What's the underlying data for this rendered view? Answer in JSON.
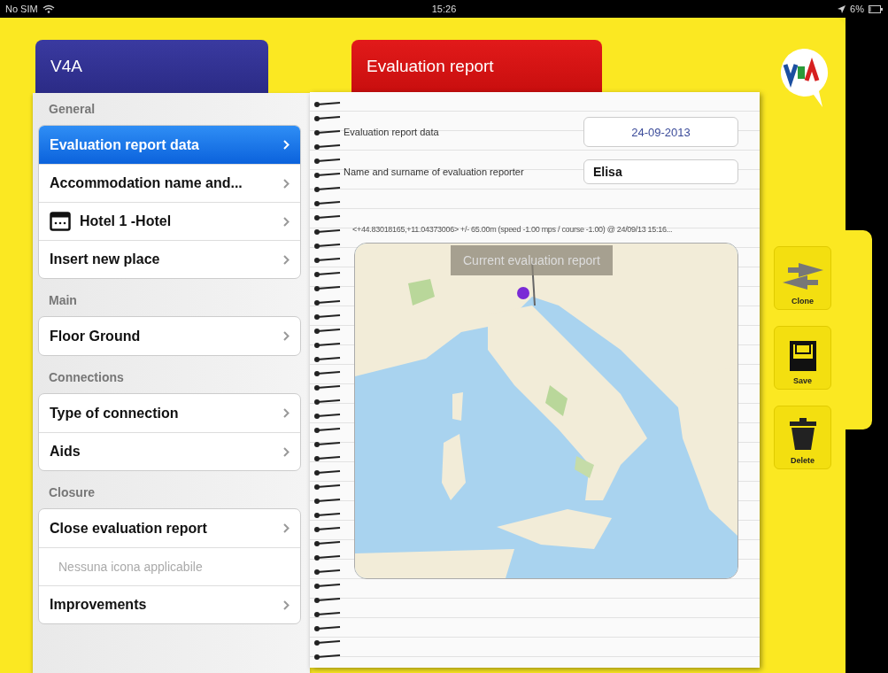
{
  "status_bar": {
    "carrier": "No SIM",
    "time": "15:26",
    "battery": "6%"
  },
  "left_tab": {
    "title": "V4A"
  },
  "sections": [
    {
      "header": "General",
      "items": [
        {
          "kind": "link",
          "label": "Evaluation report data",
          "selected": true
        },
        {
          "kind": "link",
          "label": "Accommodation name and...",
          "selected": false
        },
        {
          "kind": "icon-link",
          "label": "Hotel 1 -Hotel",
          "selected": false
        },
        {
          "kind": "link",
          "label": "Insert new place",
          "selected": false
        }
      ]
    },
    {
      "header": "Main",
      "items": [
        {
          "kind": "link",
          "label": "Floor Ground",
          "selected": false
        }
      ]
    },
    {
      "header": "Connections",
      "items": [
        {
          "kind": "link",
          "label": "Type of connection",
          "selected": false
        },
        {
          "kind": "link",
          "label": "Aids",
          "selected": false
        }
      ]
    },
    {
      "header": "Closure",
      "items": [
        {
          "kind": "link",
          "label": "Close evaluation report",
          "selected": false
        },
        {
          "kind": "note",
          "label": "Nessuna icona applicabile",
          "selected": false
        },
        {
          "kind": "link",
          "label": "Improvements",
          "selected": false
        }
      ]
    }
  ],
  "report_tab": {
    "title": "Evaluation report"
  },
  "form": [
    {
      "label": "Evaluation report data",
      "value": "24-09-2013",
      "kind": "date"
    },
    {
      "label": "Name and surname of evaluation reporter",
      "value": "Elisa",
      "kind": "text"
    }
  ],
  "location": "<+44.83018165,+11.04373006> +/- 65.00m (speed -1.00 mps / course -1.00) @ 24/09/13 15:16...",
  "map": {
    "kind": "picture",
    "callout": "Current evaluation report"
  },
  "actions": [
    {
      "kind": "clone",
      "label": "Clone"
    },
    {
      "kind": "save",
      "label": "Save"
    },
    {
      "kind": "delete",
      "label": "Delete"
    }
  ]
}
